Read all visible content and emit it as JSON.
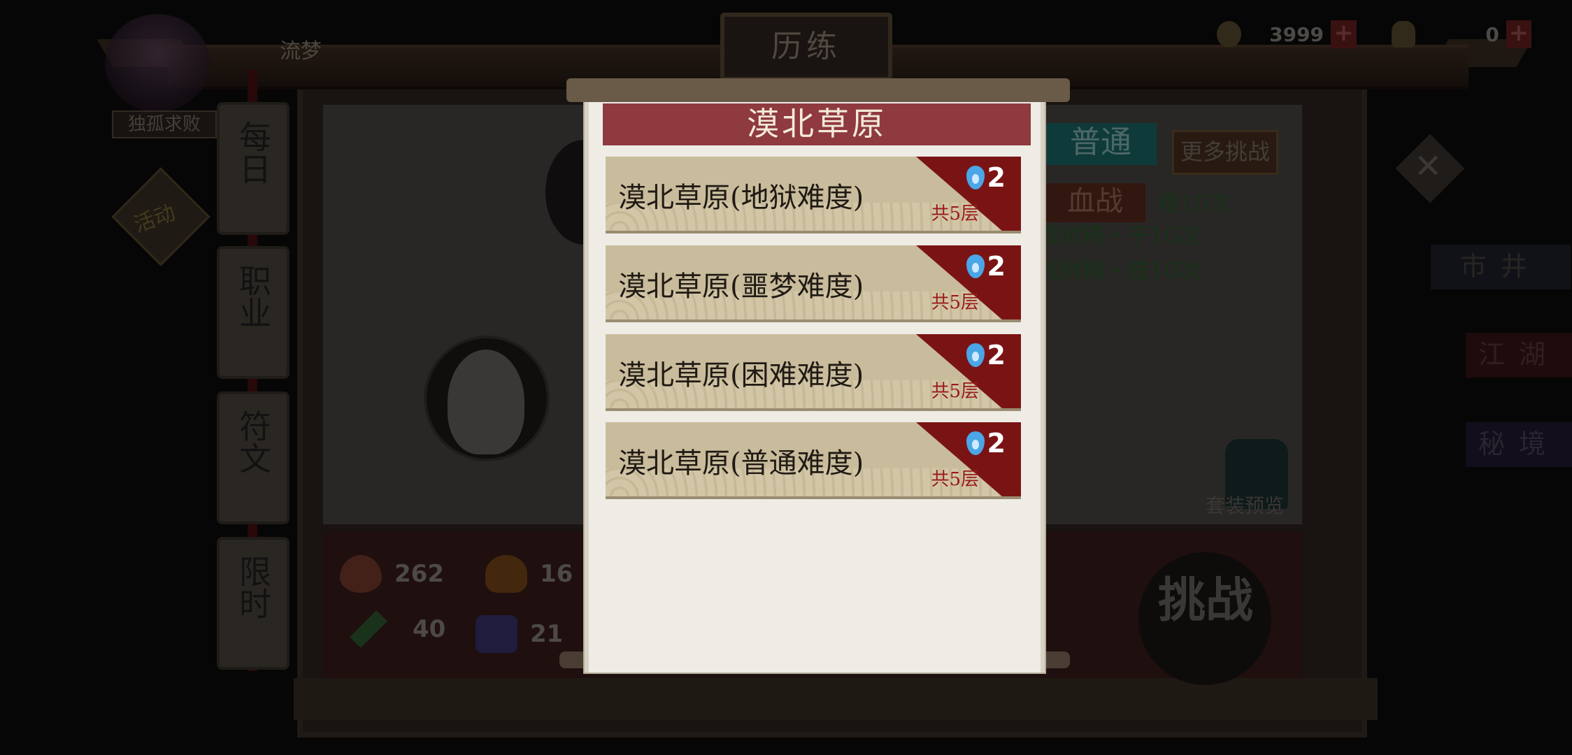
{
  "header": {
    "title": "历练",
    "player_name": "流梦",
    "player_rank": "独孤求败"
  },
  "currency": {
    "coins": "3999",
    "gold": "0"
  },
  "side_tabs": [
    {
      "label": "每日"
    },
    {
      "label": "职业"
    },
    {
      "label": "符文"
    },
    {
      "label": "限时"
    }
  ],
  "activity_label": "活动",
  "stats": {
    "hp": "262",
    "fire": "16",
    "attack": "40",
    "defense": "21"
  },
  "modes": {
    "normal": "普通",
    "blood_battle": "血战",
    "more_challenges": "更多挑战"
  },
  "tasks": [
    "根10次",
    "栽树精・干10次",
    "栽树精・枝10次"
  ],
  "right_nav": {
    "market": "市井",
    "jianghu": "江湖",
    "mijing": "秘境"
  },
  "set_preview": "套装预览",
  "challenge_button": "挑战",
  "modal": {
    "title": "漠北草原",
    "stages": [
      {
        "name": "漠北草原(地狱难度)",
        "cost": "2",
        "floors": "共5层"
      },
      {
        "name": "漠北草原(噩梦难度)",
        "cost": "2",
        "floors": "共5层"
      },
      {
        "name": "漠北草原(困难难度)",
        "cost": "2",
        "floors": "共5层"
      },
      {
        "name": "漠北草原(普通难度)",
        "cost": "2",
        "floors": "共5层"
      }
    ]
  },
  "colors": {
    "modal_title_bg": "#8e3a3e",
    "stage_bg": "#c9bc9c",
    "stage_corner": "#7a1414",
    "cost_icon": "#4aa6e6",
    "floors_text": "#9a1a1a"
  }
}
